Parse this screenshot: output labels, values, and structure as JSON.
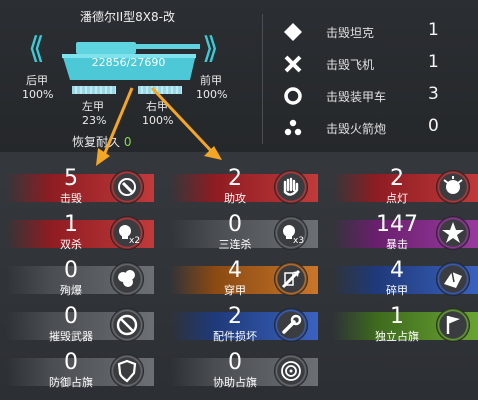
{
  "header": {
    "tank_name": "潘德尔II型8X8-改",
    "hp": "22856/27690",
    "rear_armor_label": "后甲",
    "rear_armor_value": "100%",
    "front_armor_label": "前甲",
    "front_armor_value": "100%",
    "left_armor_label": "左甲",
    "left_armor_value": "23%",
    "right_armor_label": "右甲",
    "right_armor_value": "100%",
    "recover_label": "恢复耐久",
    "recover_value": "0"
  },
  "kill_stats": [
    {
      "icon": "diamond-icon",
      "label": "击毁坦克",
      "count": "1"
    },
    {
      "icon": "cross-icon",
      "label": "击毁飞机",
      "count": "1"
    },
    {
      "icon": "ring-icon",
      "label": "击毁装甲车",
      "count": "3"
    },
    {
      "icon": "triangle-dots-icon",
      "label": "击毁火箭炮",
      "count": "0"
    }
  ],
  "medals": [
    {
      "id": "kill",
      "num": "5",
      "label": "击毁",
      "icon": "target-hammer-icon",
      "color": "#8e1c22",
      "accent": "#c23a3a"
    },
    {
      "id": "assist",
      "num": "2",
      "label": "助攻",
      "icon": "hand-icon",
      "color": "#8e1c22",
      "accent": "#c23a3a"
    },
    {
      "id": "spot",
      "num": "2",
      "label": "点灯",
      "icon": "flash-icon",
      "color": "#8e1c22",
      "accent": "#c23a3a"
    },
    {
      "id": "double",
      "num": "1",
      "label": "双杀",
      "icon": "skull-x2-icon",
      "color": "#8e1c22",
      "accent": "#c23a3a"
    },
    {
      "id": "triple",
      "num": "0",
      "label": "三连杀",
      "icon": "skull-x3-icon",
      "color": "#4a4d52",
      "accent": "#6c6f74"
    },
    {
      "id": "crit",
      "num": "147",
      "label": "暴击",
      "icon": "burst-icon",
      "color": "#6a1f6e",
      "accent": "#9a3aa0"
    },
    {
      "id": "explode",
      "num": "0",
      "label": "殉爆",
      "icon": "explosion-icon",
      "color": "#4a4d52",
      "accent": "#6c6f74"
    },
    {
      "id": "pierce",
      "num": "4",
      "label": "穿甲",
      "icon": "pierce-icon",
      "color": "#8a4a12",
      "accent": "#c9762a"
    },
    {
      "id": "shatter",
      "num": "4",
      "label": "碎甲",
      "icon": "shatter-icon",
      "color": "#1f3a7a",
      "accent": "#3a62c0"
    },
    {
      "id": "disarm",
      "num": "0",
      "label": "摧毁武器",
      "icon": "no-weapon-icon",
      "color": "#4a4d52",
      "accent": "#6c6f74"
    },
    {
      "id": "parts",
      "num": "2",
      "label": "配件损坏",
      "icon": "wrench-icon",
      "color": "#1f3a7a",
      "accent": "#3a62c0"
    },
    {
      "id": "capture",
      "num": "1",
      "label": "独立占旗",
      "icon": "flag-icon",
      "color": "#3e6a1e",
      "accent": "#6aa632"
    },
    {
      "id": "defend",
      "num": "0",
      "label": "防御占旗",
      "icon": "shield-icon",
      "color": "#4a4d52",
      "accent": "#6c6f74"
    },
    {
      "id": "assistcap",
      "num": "0",
      "label": "协助占旗",
      "icon": "radar-icon",
      "color": "#4a4d52",
      "accent": "#6c6f74"
    }
  ]
}
